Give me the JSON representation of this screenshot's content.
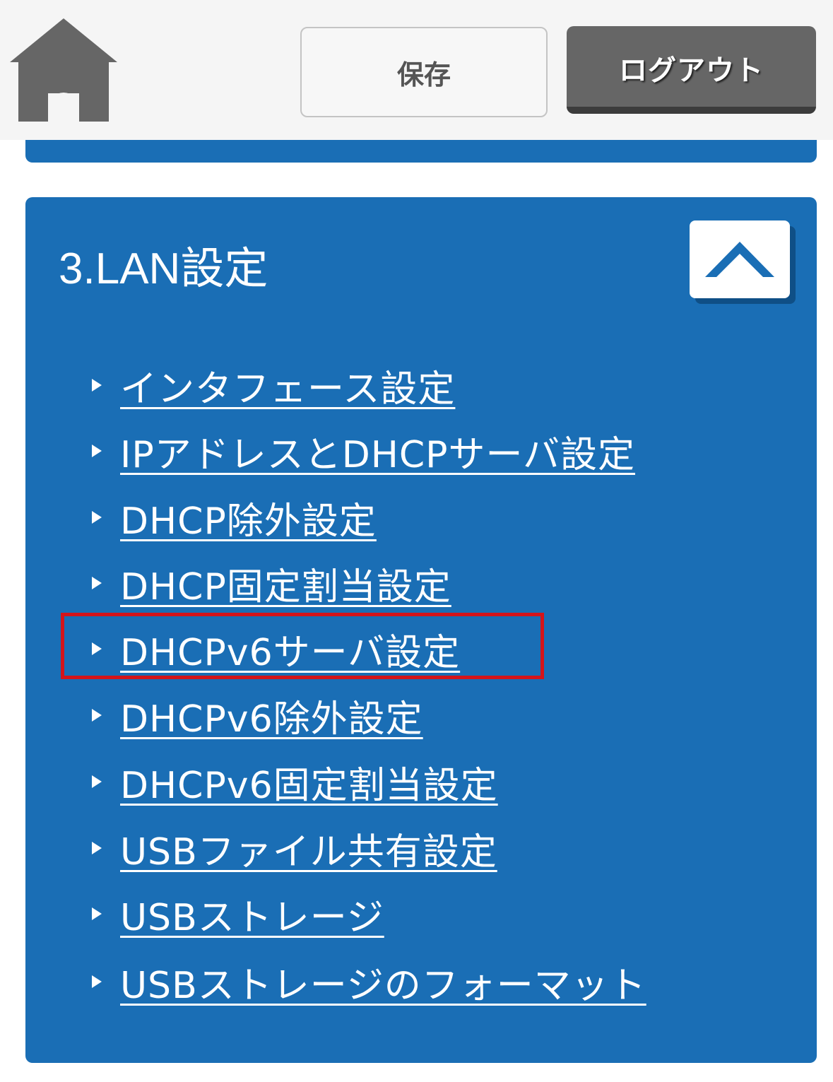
{
  "header": {
    "home_icon": "home-icon",
    "save_label": "保存",
    "logout_label": "ログアウト"
  },
  "lan_panel": {
    "title": "3.LAN設定",
    "collapse_icon": "chevron-up-icon",
    "items": [
      {
        "label": "インタフェース設定",
        "highlighted": false
      },
      {
        "label": "IPアドレスとDHCPサーバ設定",
        "highlighted": false
      },
      {
        "label": "DHCP除外設定",
        "highlighted": false
      },
      {
        "label": "DHCP固定割当設定",
        "highlighted": false
      },
      {
        "label": "DHCPv6サーバ設定",
        "highlighted": true
      },
      {
        "label": "DHCPv6除外設定",
        "highlighted": false
      },
      {
        "label": "DHCPv6固定割当設定",
        "highlighted": false
      },
      {
        "label": "USBファイル共有設定",
        "highlighted": false
      },
      {
        "label": "USBストレージ",
        "highlighted": false
      },
      {
        "label": "USBストレージのフォーマット",
        "highlighted": false
      }
    ]
  },
  "colors": {
    "panel_blue": "#1a6eb5",
    "header_bg": "#f5f5f5",
    "logout_bg": "#666666",
    "highlight_red": "#d4141a",
    "home_icon_gray": "#666666"
  }
}
